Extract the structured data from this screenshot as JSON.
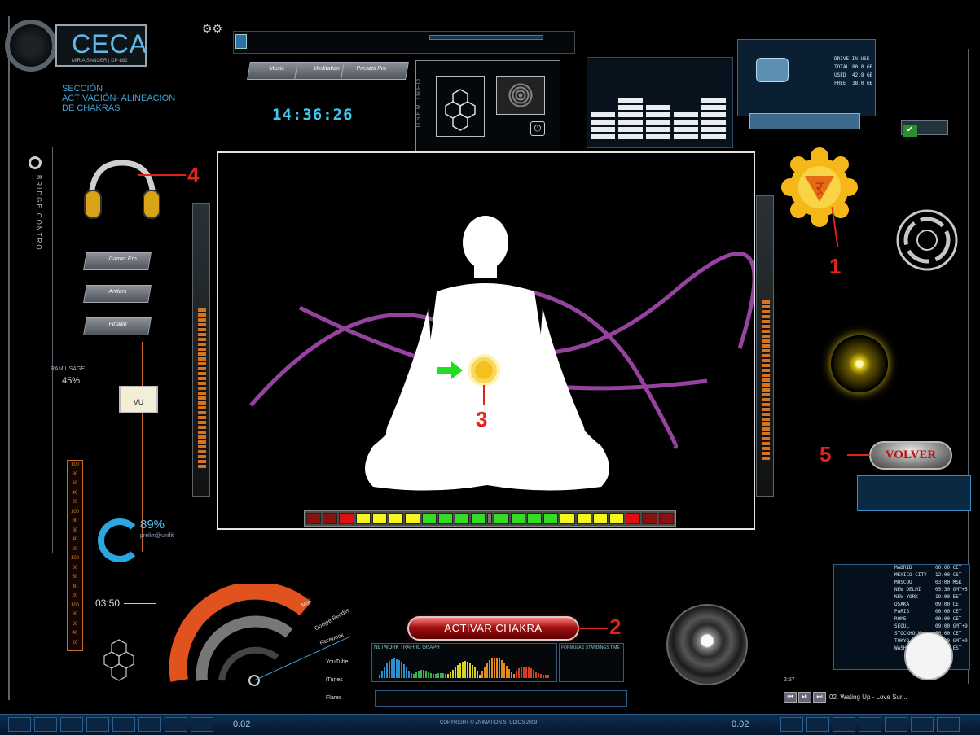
{
  "header": {
    "logo": "CECA",
    "logo_sub": "MIRIA SANGER | DP-882",
    "section_line1": "SECCIÓN",
    "section_line2": "ACTIVACIÓN- ALINEACION",
    "section_line3": "DE CHAKRAS",
    "clock": "14:36:26",
    "top_tabs": [
      "Music",
      "Meditation",
      "Presets Pro"
    ],
    "user_info_label": "USER INFO",
    "ram_label": "RAM USAGE",
    "ram_value": "45%",
    "side_label": "BRIDGE CONTROL"
  },
  "left_panel": {
    "menu_items": [
      "Gamer Ero",
      "Antlers",
      "Finallin"
    ],
    "vu_label": "VU",
    "donut_percent": "89%",
    "donut_caption": "prelim@unifit",
    "time_readout": "03:50",
    "arc_items": [
      "Mail",
      "Google Reader",
      "Facebook",
      "YouTube",
      "iTunes",
      "Flares"
    ],
    "arc_scale": [
      "100",
      "80",
      "60",
      "40",
      "20",
      "100",
      "80",
      "60",
      "40",
      "20",
      "100",
      "80",
      "60",
      "40",
      "20",
      "100",
      "80",
      "60",
      "40",
      "20"
    ]
  },
  "main": {
    "activate_button": "ACTIVAR CHAKRA",
    "vu_colors": [
      "#8b1010",
      "#8b1010",
      "#e01010",
      "#f5f520",
      "#f5f520",
      "#f5f520",
      "#f5f520",
      "#33dd22",
      "#33dd22",
      "#33dd22",
      "#33dd22",
      "#444444",
      "#33dd22",
      "#33dd22",
      "#33dd22",
      "#33dd22",
      "#f5f520",
      "#f5f520",
      "#f5f520",
      "#f5f520",
      "#e01010",
      "#8b1010",
      "#8b1010"
    ],
    "traffic_label": "NETWORK TRAFFIC GRAPH",
    "formula_label": "FORMULA 1 STANDINGS TIME"
  },
  "callouts": {
    "n1": "1",
    "n2": "2",
    "n3": "3",
    "n4": "4",
    "n5": "5"
  },
  "right_panel": {
    "volver_button": "VOLVER",
    "sys_labels": [
      "DRIVE IN USE",
      "TOTAL",
      "USED",
      "FREE"
    ],
    "sys_values": [
      "",
      "80.8 GB",
      "42.8 GB",
      "38.0 GB"
    ],
    "world_clock": [
      [
        "MADRID",
        "00:00 CET"
      ],
      [
        "MEXICO CITY",
        "12:00 CST"
      ],
      [
        "MOSCOU",
        "03:00 MSK"
      ],
      [
        "NEW DELHI",
        "05:30 GMT+5"
      ],
      [
        "NEW YORK",
        "19:00 EST"
      ],
      [
        "OSAKA",
        "09:00 CET"
      ],
      [
        "PARIS",
        "00:00 CET"
      ],
      [
        "ROME",
        "00:00 CET"
      ],
      [
        "SEOUL",
        "09:00 GMT+9"
      ],
      [
        "STOCKHOLM",
        "00:00 CET"
      ],
      [
        "TOKYO",
        "09:00 GMT+9"
      ],
      [
        "WASHINGTON",
        "19:00 EST"
      ]
    ],
    "media_track": "02. Wating Up - Love Sur...",
    "media_time": "2:57"
  },
  "footer": {
    "copyright": "COPYRIGHT © ZNIMATION STUDIOS 2009",
    "left_readout": "0.02",
    "right_readout": "0.02"
  },
  "colors": {
    "accent_blue": "#3ec8ec",
    "callout_red": "#e0241a",
    "chakra_yellow": "#f6c32a",
    "ribbon_purple": "#a64bb0"
  }
}
